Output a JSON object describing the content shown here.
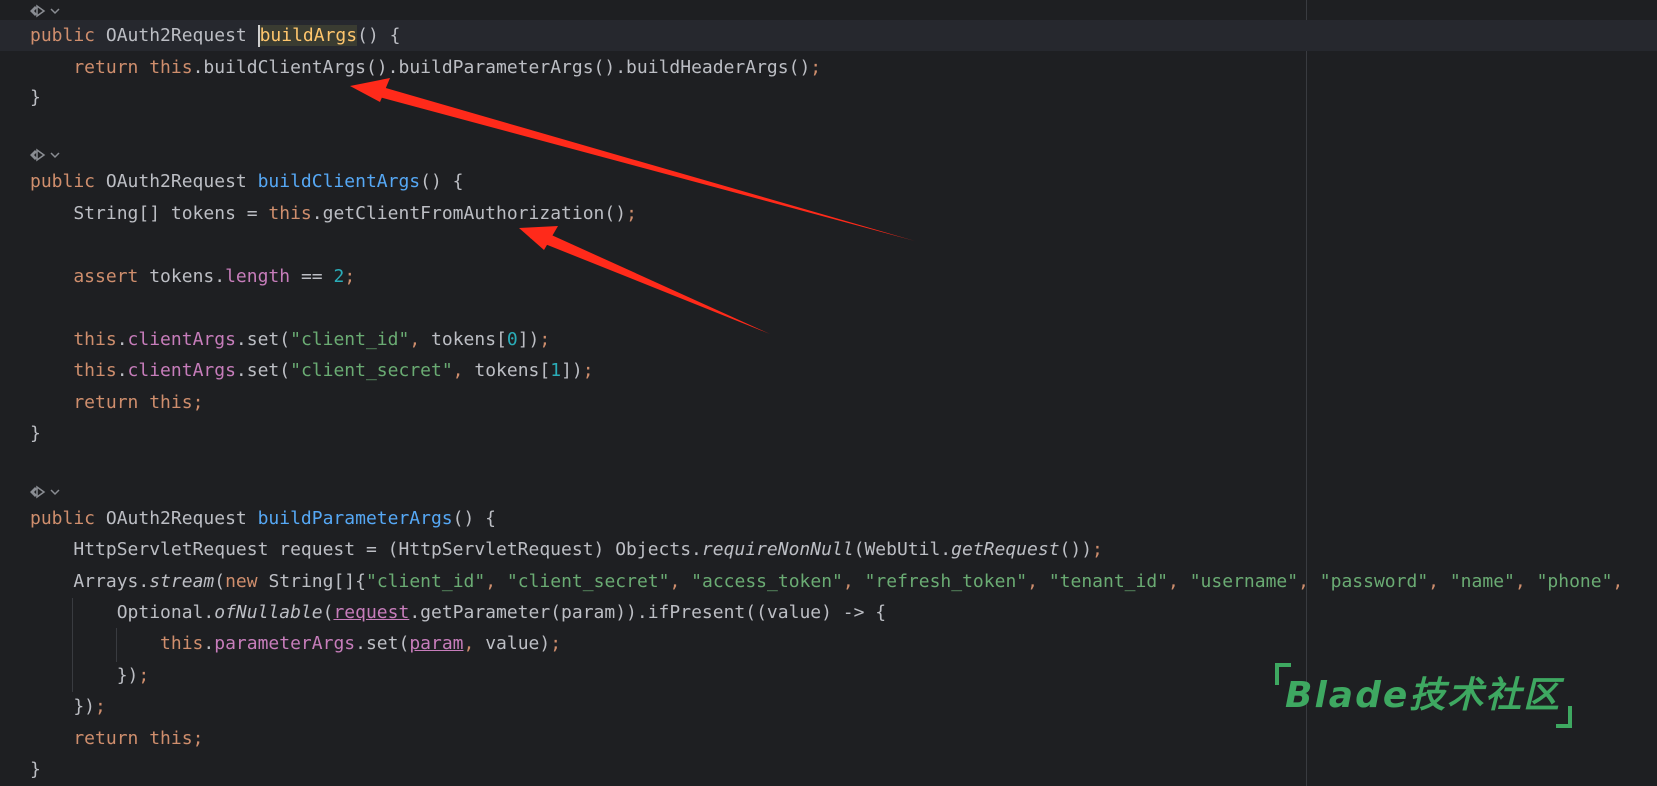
{
  "editor": {
    "language": "java",
    "lines": [
      {
        "tokens": [
          {
            "t": "public ",
            "c": "kw"
          },
          {
            "t": "OAuth2Request ",
            "c": ""
          },
          {
            "t": "buildArgs",
            "c": "hi"
          },
          {
            "t": "() {",
            "c": ""
          }
        ]
      },
      {
        "tokens": [
          {
            "t": "    return ",
            "c": "kw"
          },
          {
            "t": "this",
            "c": "kw"
          },
          {
            "t": ".buildClientArgs().buildParameterArgs().buildHeaderArgs()",
            "c": ""
          },
          {
            "t": ";",
            "c": "kw"
          }
        ]
      },
      {
        "tokens": [
          {
            "t": "}",
            "c": ""
          }
        ]
      },
      {
        "tokens": [
          {
            "t": "public ",
            "c": "kw"
          },
          {
            "t": "OAuth2Request ",
            "c": ""
          },
          {
            "t": "buildClientArgs",
            "c": "fn-decl"
          },
          {
            "t": "() {",
            "c": ""
          }
        ]
      },
      {
        "tokens": [
          {
            "t": "    String[] tokens = ",
            "c": ""
          },
          {
            "t": "this",
            "c": "kw"
          },
          {
            "t": ".getClientFromAuthorization()",
            "c": ""
          },
          {
            "t": ";",
            "c": "kw"
          }
        ]
      },
      {
        "tokens": [
          {
            "t": "    assert ",
            "c": "kw"
          },
          {
            "t": "tokens.",
            "c": ""
          },
          {
            "t": "length",
            "c": "field"
          },
          {
            "t": " == ",
            "c": ""
          },
          {
            "t": "2",
            "c": "num"
          },
          {
            "t": ";",
            "c": "kw"
          }
        ]
      },
      {
        "tokens": [
          {
            "t": "    this",
            "c": "kw"
          },
          {
            "t": ".",
            "c": ""
          },
          {
            "t": "clientArgs",
            "c": "field"
          },
          {
            "t": ".set(",
            "c": ""
          },
          {
            "t": "\"client_id\"",
            "c": "str"
          },
          {
            "t": ", ",
            "c": "kw"
          },
          {
            "t": "tokens[",
            "c": ""
          },
          {
            "t": "0",
            "c": "num"
          },
          {
            "t": "])",
            "c": ""
          },
          {
            "t": ";",
            "c": "kw"
          }
        ]
      },
      {
        "tokens": [
          {
            "t": "    this",
            "c": "kw"
          },
          {
            "t": ".",
            "c": ""
          },
          {
            "t": "clientArgs",
            "c": "field"
          },
          {
            "t": ".set(",
            "c": ""
          },
          {
            "t": "\"client_secret\"",
            "c": "str"
          },
          {
            "t": ", ",
            "c": "kw"
          },
          {
            "t": "tokens[",
            "c": ""
          },
          {
            "t": "1",
            "c": "num"
          },
          {
            "t": "])",
            "c": ""
          },
          {
            "t": ";",
            "c": "kw"
          }
        ]
      },
      {
        "tokens": [
          {
            "t": "    return ",
            "c": "kw"
          },
          {
            "t": "this",
            "c": "kw"
          },
          {
            "t": ";",
            "c": "kw"
          }
        ]
      },
      {
        "tokens": [
          {
            "t": "}",
            "c": ""
          }
        ]
      },
      {
        "tokens": [
          {
            "t": "public ",
            "c": "kw"
          },
          {
            "t": "OAuth2Request ",
            "c": ""
          },
          {
            "t": "buildParameterArgs",
            "c": "fn-decl"
          },
          {
            "t": "() {",
            "c": ""
          }
        ]
      },
      {
        "tokens": [
          {
            "t": "    HttpServletRequest request = (HttpServletRequest) Objects.",
            "c": ""
          },
          {
            "t": "requireNonNull",
            "c": "ital-fn"
          },
          {
            "t": "(WebUtil.",
            "c": ""
          },
          {
            "t": "getRequest",
            "c": "ital-fn"
          },
          {
            "t": "())",
            "c": ""
          },
          {
            "t": ";",
            "c": "kw"
          }
        ]
      },
      {
        "tokens": [
          {
            "t": "    Arrays.",
            "c": ""
          },
          {
            "t": "stream",
            "c": "ital-fn"
          },
          {
            "t": "(",
            "c": ""
          },
          {
            "t": "new ",
            "c": "kw"
          },
          {
            "t": "String[]{",
            "c": ""
          },
          {
            "t": "\"client_id\"",
            "c": "str"
          },
          {
            "t": ", ",
            "c": "kw"
          },
          {
            "t": "\"client_secret\"",
            "c": "str"
          },
          {
            "t": ", ",
            "c": "kw"
          },
          {
            "t": "\"access_token\"",
            "c": "str"
          },
          {
            "t": ", ",
            "c": "kw"
          },
          {
            "t": "\"refresh_token\"",
            "c": "str"
          },
          {
            "t": ", ",
            "c": "kw"
          },
          {
            "t": "\"tenant_id\"",
            "c": "str"
          },
          {
            "t": ", ",
            "c": "kw"
          },
          {
            "t": "\"username\"",
            "c": "str"
          },
          {
            "t": ", ",
            "c": "kw"
          },
          {
            "t": "\"password\"",
            "c": "str"
          },
          {
            "t": ", ",
            "c": "kw"
          },
          {
            "t": "\"name\"",
            "c": "str"
          },
          {
            "t": ", ",
            "c": "kw"
          },
          {
            "t": "\"phone\"",
            "c": "str"
          },
          {
            "t": ",",
            "c": "kw"
          }
        ]
      },
      {
        "tokens": [
          {
            "t": "        Optional.",
            "c": ""
          },
          {
            "t": "ofNullable",
            "c": "ital-fn"
          },
          {
            "t": "(",
            "c": ""
          },
          {
            "t": "request",
            "c": "uline"
          },
          {
            "t": ".getParameter(param)).ifPresent((value) -> {",
            "c": ""
          }
        ]
      },
      {
        "tokens": [
          {
            "t": "            this",
            "c": "kw"
          },
          {
            "t": ".",
            "c": ""
          },
          {
            "t": "parameterArgs",
            "c": "field"
          },
          {
            "t": ".set(",
            "c": ""
          },
          {
            "t": "param",
            "c": "uline"
          },
          {
            "t": ", ",
            "c": "kw"
          },
          {
            "t": "value)",
            "c": ""
          },
          {
            "t": ";",
            "c": "kw"
          }
        ]
      },
      {
        "tokens": [
          {
            "t": "        })",
            "c": ""
          },
          {
            "t": ";",
            "c": "kw"
          }
        ]
      },
      {
        "tokens": [
          {
            "t": "    })",
            "c": ""
          },
          {
            "t": ";",
            "c": "kw"
          }
        ]
      },
      {
        "tokens": [
          {
            "t": "    return ",
            "c": "kw"
          },
          {
            "t": "this",
            "c": "kw"
          },
          {
            "t": ";",
            "c": "kw"
          }
        ]
      },
      {
        "tokens": [
          {
            "t": "}",
            "c": ""
          }
        ]
      }
    ]
  },
  "watermark": {
    "text": "Blade技术社区"
  },
  "colors": {
    "background": "#1e1f22",
    "keyword": "#cf8e6d",
    "string": "#6aab73",
    "number": "#2aacb8",
    "field": "#c77dbb",
    "method_decl": "#56a8f5",
    "arrow": "#ff2a1a",
    "watermark": "#3ea861"
  }
}
